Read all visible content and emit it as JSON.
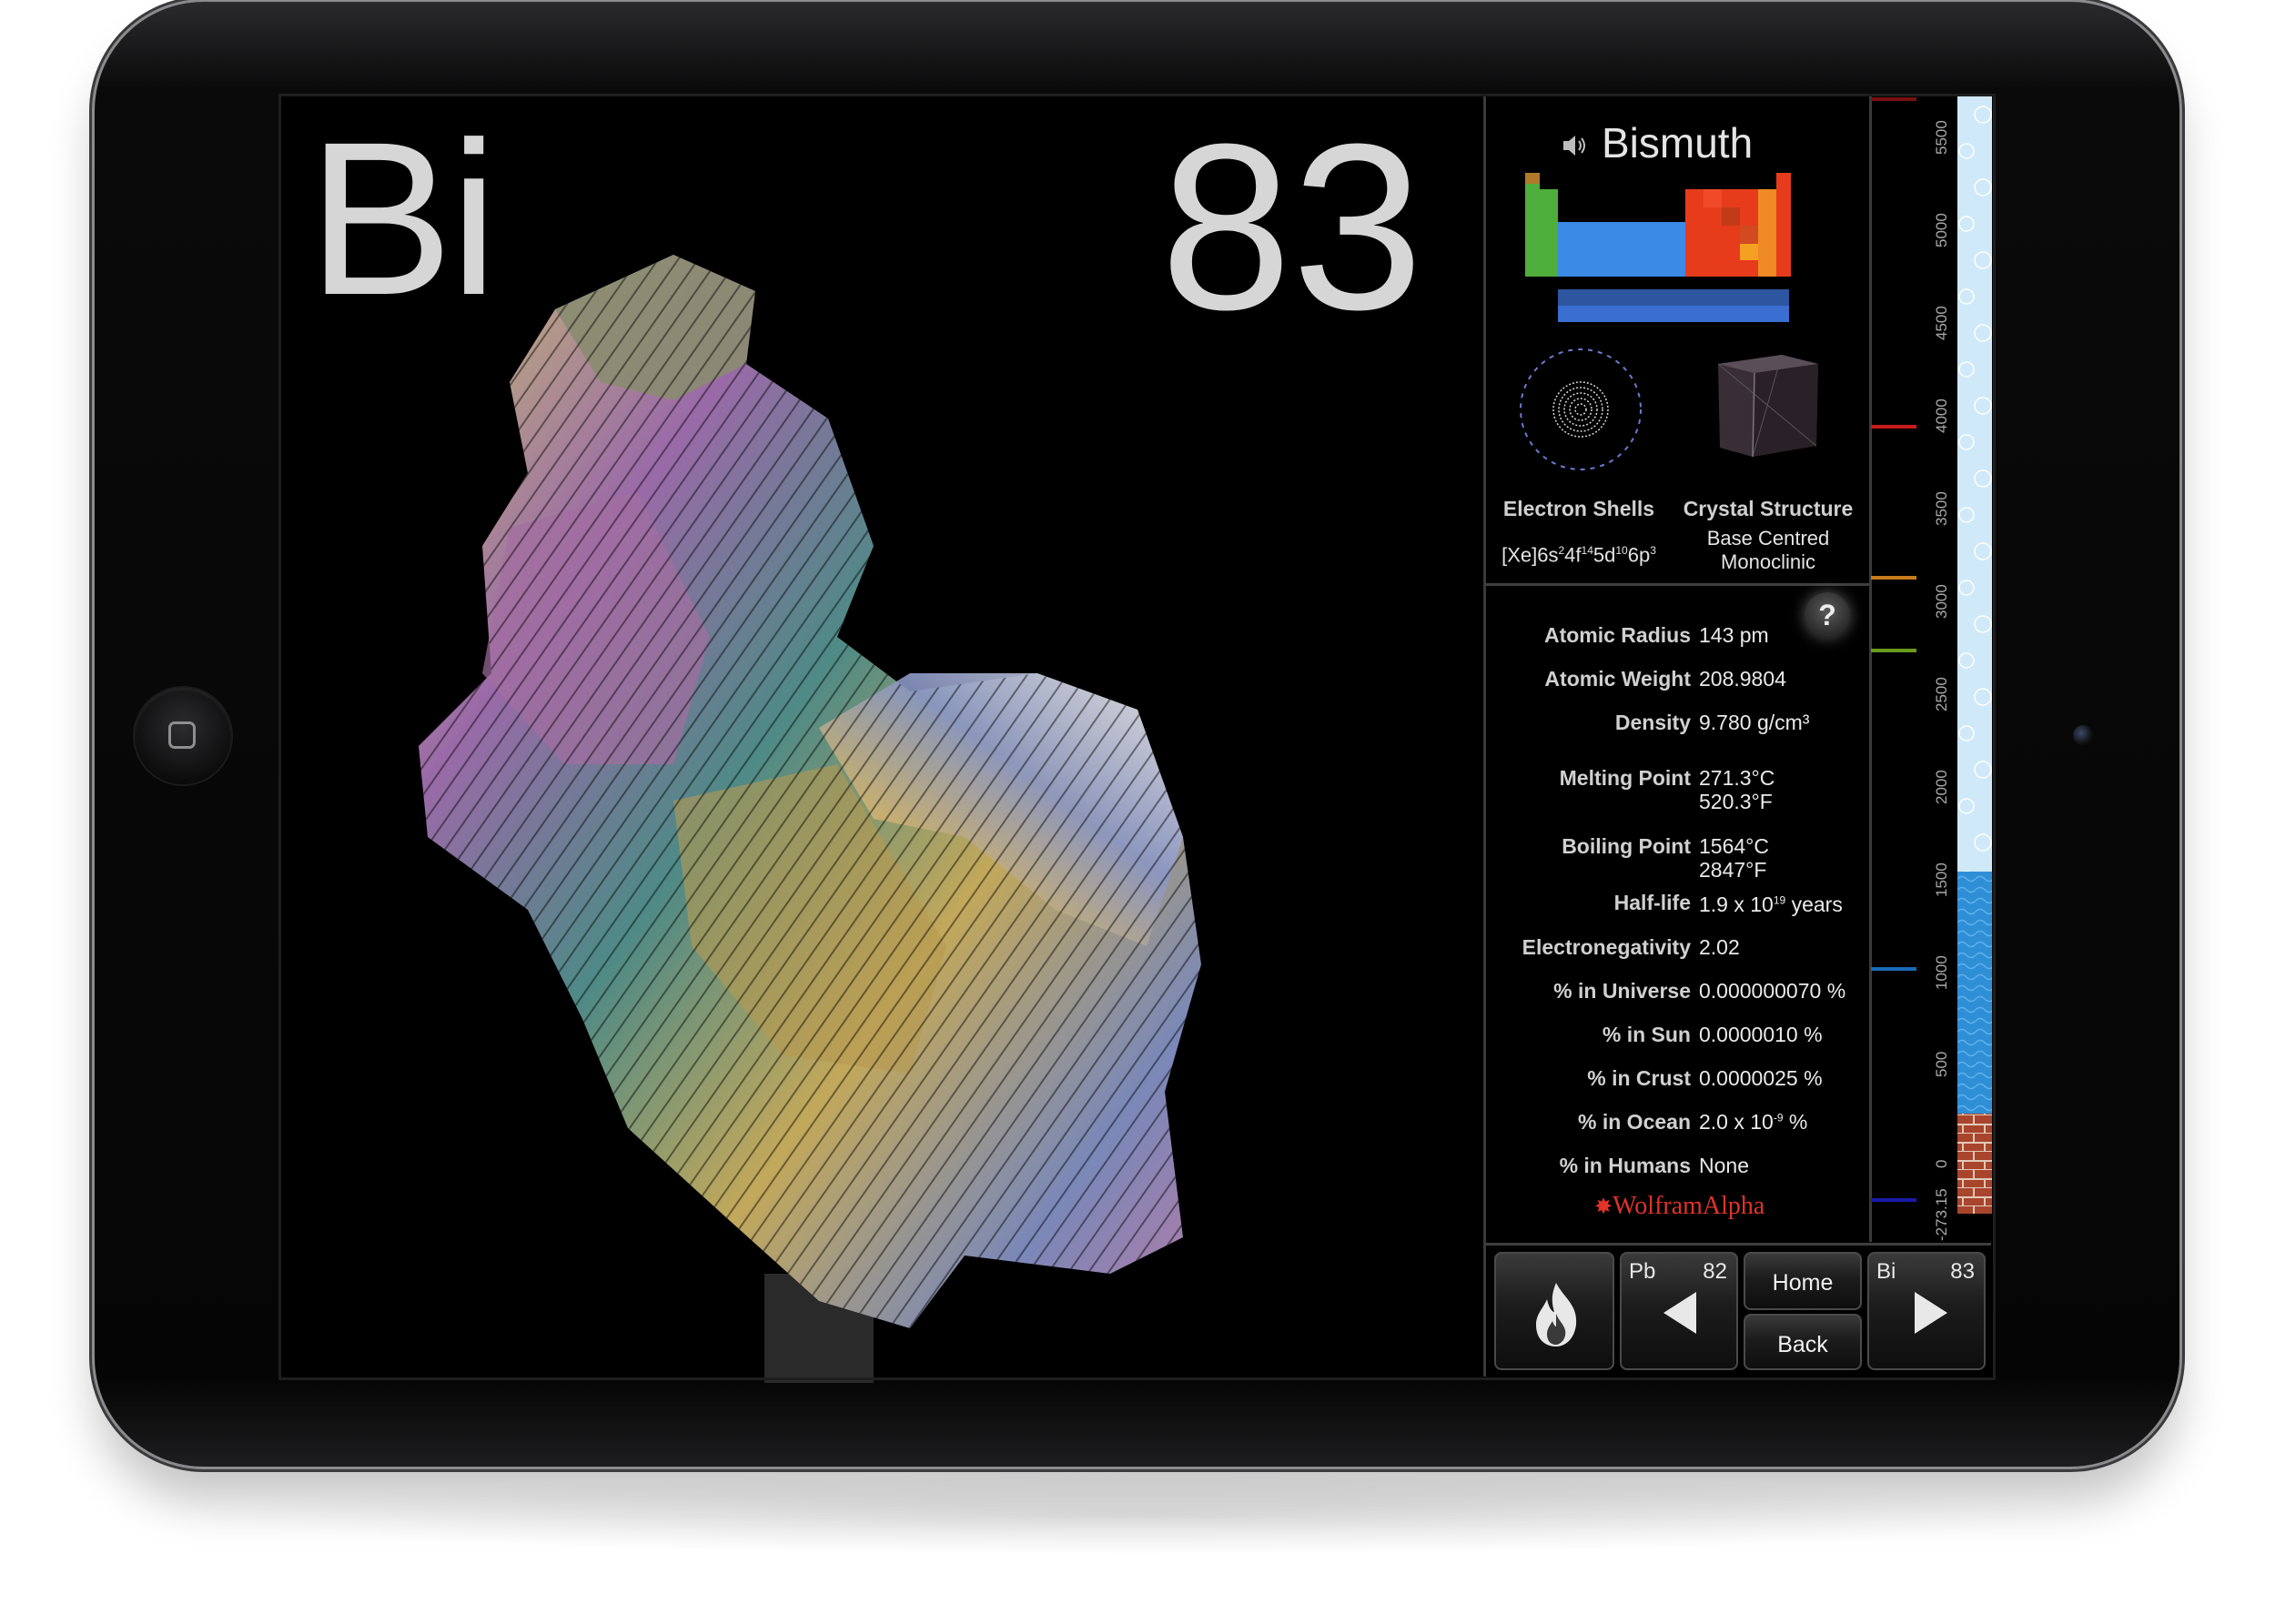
{
  "element": {
    "symbol": "Bi",
    "atomic_number": "83",
    "name": "Bismuth"
  },
  "sections": {
    "electron_shells_label": "Electron Shells",
    "electron_config_parts": [
      "[Xe]6s",
      "2",
      "4f",
      "14",
      "5d",
      "10",
      "6p",
      "3"
    ],
    "crystal_structure_label": "Crystal Structure",
    "crystal_structure_line1": "Base Centred",
    "crystal_structure_line2": "Monoclinic"
  },
  "help_label": "?",
  "properties": [
    {
      "label": "Atomic Radius",
      "value": "143 pm"
    },
    {
      "label": "Atomic Weight",
      "value": "208.9804"
    },
    {
      "label": "Density",
      "value": "9.780 g/cm³"
    },
    {
      "label": "Melting Point",
      "value": "271.3°C",
      "value2": "520.3°F"
    },
    {
      "label": "Boiling Point",
      "value": "1564°C",
      "value2": "2847°F"
    },
    {
      "label": "Half-life",
      "value_base": "1.9 x 10",
      "value_exp": "19",
      "value_unit": " years"
    },
    {
      "label": "Electronegativity",
      "value": "2.02"
    },
    {
      "label": "% in Universe",
      "value": "0.000000070 %"
    },
    {
      "label": "% in Sun",
      "value": "0.0000010 %"
    },
    {
      "label": "% in Crust",
      "value": "0.0000025 %"
    },
    {
      "label": "% in Ocean",
      "value_base": "2.0 x 10",
      "value_exp": "-9",
      "value_unit": " %"
    },
    {
      "label": "% in Humans",
      "value": "None"
    }
  ],
  "wolfram_label": "WolframAlpha",
  "temperature_scale": {
    "ticks": [
      "5500",
      "5000",
      "4500",
      "4000",
      "3500",
      "3000",
      "2500",
      "2000",
      "1500",
      "1000",
      "500",
      "0",
      "-273.15"
    ],
    "colors": {
      "gas": "#cfe9f9",
      "liquid": "#2f8fd6",
      "solid": "#a8452c"
    }
  },
  "nav": {
    "fire_icon": "flame-icon",
    "prev_symbol": "Pb",
    "prev_number": "82",
    "home_label": "Home",
    "back_label": "Back",
    "next_symbol": "Bi",
    "next_number": "83"
  },
  "periodic_table_colors": {
    "s_block": "#4eae3c",
    "p_block_metals": "#e63c1c",
    "d_block": "#3b8ae6",
    "f_block": "#2d55a0",
    "highlight": "#f5a020"
  }
}
